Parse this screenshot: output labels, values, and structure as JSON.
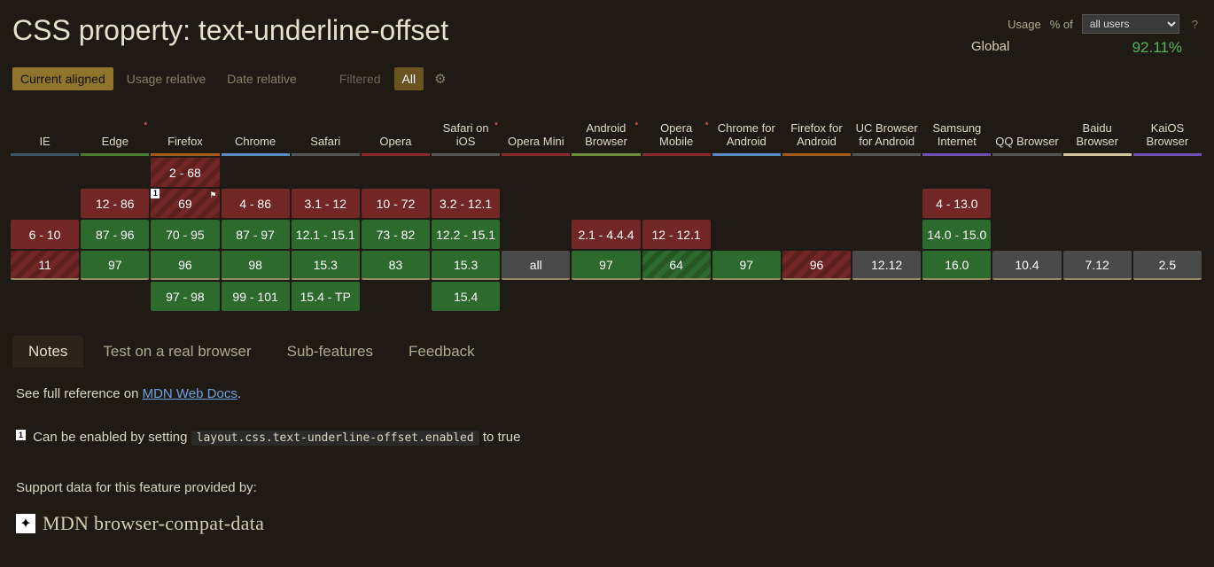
{
  "title": "CSS property: text-underline-offset",
  "usage": {
    "label": "Usage",
    "pct_label": "% of",
    "select_value": "all users",
    "global_label": "Global",
    "global_pct": "92.11%",
    "help": "?"
  },
  "filters": {
    "current": "Current aligned",
    "usage": "Usage relative",
    "date": "Date relative",
    "filtered": "Filtered",
    "all": "All"
  },
  "browsers": [
    {
      "name": "IE",
      "cls": "bb-ie",
      "star": false
    },
    {
      "name": "Edge",
      "cls": "bb-edge",
      "star": true
    },
    {
      "name": "Firefox",
      "cls": "bb-ff",
      "star": false
    },
    {
      "name": "Chrome",
      "cls": "bb-chrome",
      "star": false
    },
    {
      "name": "Safari",
      "cls": "bb-safari",
      "star": false
    },
    {
      "name": "Opera",
      "cls": "bb-opera",
      "star": false
    },
    {
      "name": "Safari on iOS",
      "cls": "bb-sios",
      "star": true
    },
    {
      "name": "Opera Mini",
      "cls": "bb-omini",
      "star": false
    },
    {
      "name": "Android Browser",
      "cls": "bb-android",
      "star": true
    },
    {
      "name": "Opera Mobile",
      "cls": "bb-omob",
      "star": true
    },
    {
      "name": "Chrome for Android",
      "cls": "bb-cand",
      "star": false
    },
    {
      "name": "Firefox for Android",
      "cls": "bb-fand",
      "star": false
    },
    {
      "name": "UC Browser for Android",
      "cls": "bb-uc",
      "star": false
    },
    {
      "name": "Samsung Internet",
      "cls": "bb-samsung",
      "star": false
    },
    {
      "name": "QQ Browser",
      "cls": "bb-qq",
      "star": false
    },
    {
      "name": "Baidu Browser",
      "cls": "bb-baidu",
      "star": false
    },
    {
      "name": "KaiOS Browser",
      "cls": "bb-kaios",
      "star": false
    }
  ],
  "rows": [
    [
      {
        "t": ""
      },
      {
        "t": ""
      },
      {
        "t": "2 - 68",
        "s": "hatched"
      },
      {
        "t": ""
      },
      {
        "t": ""
      },
      {
        "t": ""
      },
      {
        "t": ""
      },
      {
        "t": ""
      },
      {
        "t": ""
      },
      {
        "t": ""
      },
      {
        "t": ""
      },
      {
        "t": ""
      },
      {
        "t": ""
      },
      {
        "t": ""
      },
      {
        "t": ""
      },
      {
        "t": ""
      },
      {
        "t": ""
      }
    ],
    [
      {
        "t": ""
      },
      {
        "t": "12 - 86",
        "s": "sup-no"
      },
      {
        "t": "69",
        "s": "hatched",
        "note": "1",
        "flag": true
      },
      {
        "t": "4 - 86",
        "s": "sup-no"
      },
      {
        "t": "3.1 - 12",
        "s": "sup-no"
      },
      {
        "t": "10 - 72",
        "s": "sup-no"
      },
      {
        "t": "3.2 - 12.1",
        "s": "sup-no"
      },
      {
        "t": ""
      },
      {
        "t": ""
      },
      {
        "t": ""
      },
      {
        "t": ""
      },
      {
        "t": ""
      },
      {
        "t": ""
      },
      {
        "t": "4 - 13.0",
        "s": "sup-no"
      },
      {
        "t": ""
      },
      {
        "t": ""
      },
      {
        "t": ""
      }
    ],
    [
      {
        "t": "6 - 10",
        "s": "sup-no"
      },
      {
        "t": "87 - 96",
        "s": "sup-yes"
      },
      {
        "t": "70 - 95",
        "s": "sup-yes"
      },
      {
        "t": "87 - 97",
        "s": "sup-yes"
      },
      {
        "t": "12.1 - 15.1",
        "s": "sup-yes"
      },
      {
        "t": "73 - 82",
        "s": "sup-yes"
      },
      {
        "t": "12.2 - 15.1",
        "s": "sup-yes"
      },
      {
        "t": ""
      },
      {
        "t": "2.1 - 4.4.4",
        "s": "sup-no"
      },
      {
        "t": "12 - 12.1",
        "s": "sup-no"
      },
      {
        "t": ""
      },
      {
        "t": ""
      },
      {
        "t": ""
      },
      {
        "t": "14.0 - 15.0",
        "s": "sup-yes"
      },
      {
        "t": ""
      },
      {
        "t": ""
      },
      {
        "t": ""
      }
    ],
    [
      {
        "t": "11",
        "s": "hatched"
      },
      {
        "t": "97",
        "s": "sup-yes"
      },
      {
        "t": "96",
        "s": "sup-yes"
      },
      {
        "t": "98",
        "s": "sup-yes"
      },
      {
        "t": "15.3",
        "s": "sup-yes"
      },
      {
        "t": "83",
        "s": "sup-yes"
      },
      {
        "t": "15.3",
        "s": "sup-yes"
      },
      {
        "t": "all",
        "s": "sup-unk"
      },
      {
        "t": "97",
        "s": "sup-yes"
      },
      {
        "t": "64",
        "s": "hatched-g"
      },
      {
        "t": "97",
        "s": "sup-yes"
      },
      {
        "t": "96",
        "s": "hatched"
      },
      {
        "t": "12.12",
        "s": "sup-unk"
      },
      {
        "t": "16.0",
        "s": "sup-yes"
      },
      {
        "t": "10.4",
        "s": "sup-unk"
      },
      {
        "t": "7.12",
        "s": "sup-unk"
      },
      {
        "t": "2.5",
        "s": "sup-unk"
      }
    ],
    [
      {
        "t": ""
      },
      {
        "t": ""
      },
      {
        "t": "97 - 98",
        "s": "sup-yes"
      },
      {
        "t": "99 - 101",
        "s": "sup-yes"
      },
      {
        "t": "15.4 - TP",
        "s": "sup-yes"
      },
      {
        "t": ""
      },
      {
        "t": "15.4",
        "s": "sup-yes"
      },
      {
        "t": ""
      },
      {
        "t": ""
      },
      {
        "t": ""
      },
      {
        "t": ""
      },
      {
        "t": ""
      },
      {
        "t": ""
      },
      {
        "t": ""
      },
      {
        "t": ""
      },
      {
        "t": ""
      },
      {
        "t": ""
      }
    ]
  ],
  "tabs": [
    "Notes",
    "Test on a real browser",
    "Sub-features",
    "Feedback"
  ],
  "notes": {
    "reference_prefix": "See full reference on ",
    "reference_link": "MDN Web Docs",
    "reference_suffix": ".",
    "note1_idx": "1",
    "note1_prefix": " Can be enabled by setting ",
    "note1_code": "layout.css.text-underline-offset.enabled",
    "note1_suffix": " to true",
    "support_label": "Support data for this feature provided by:",
    "logo_text": "MDN browser-compat-data"
  }
}
